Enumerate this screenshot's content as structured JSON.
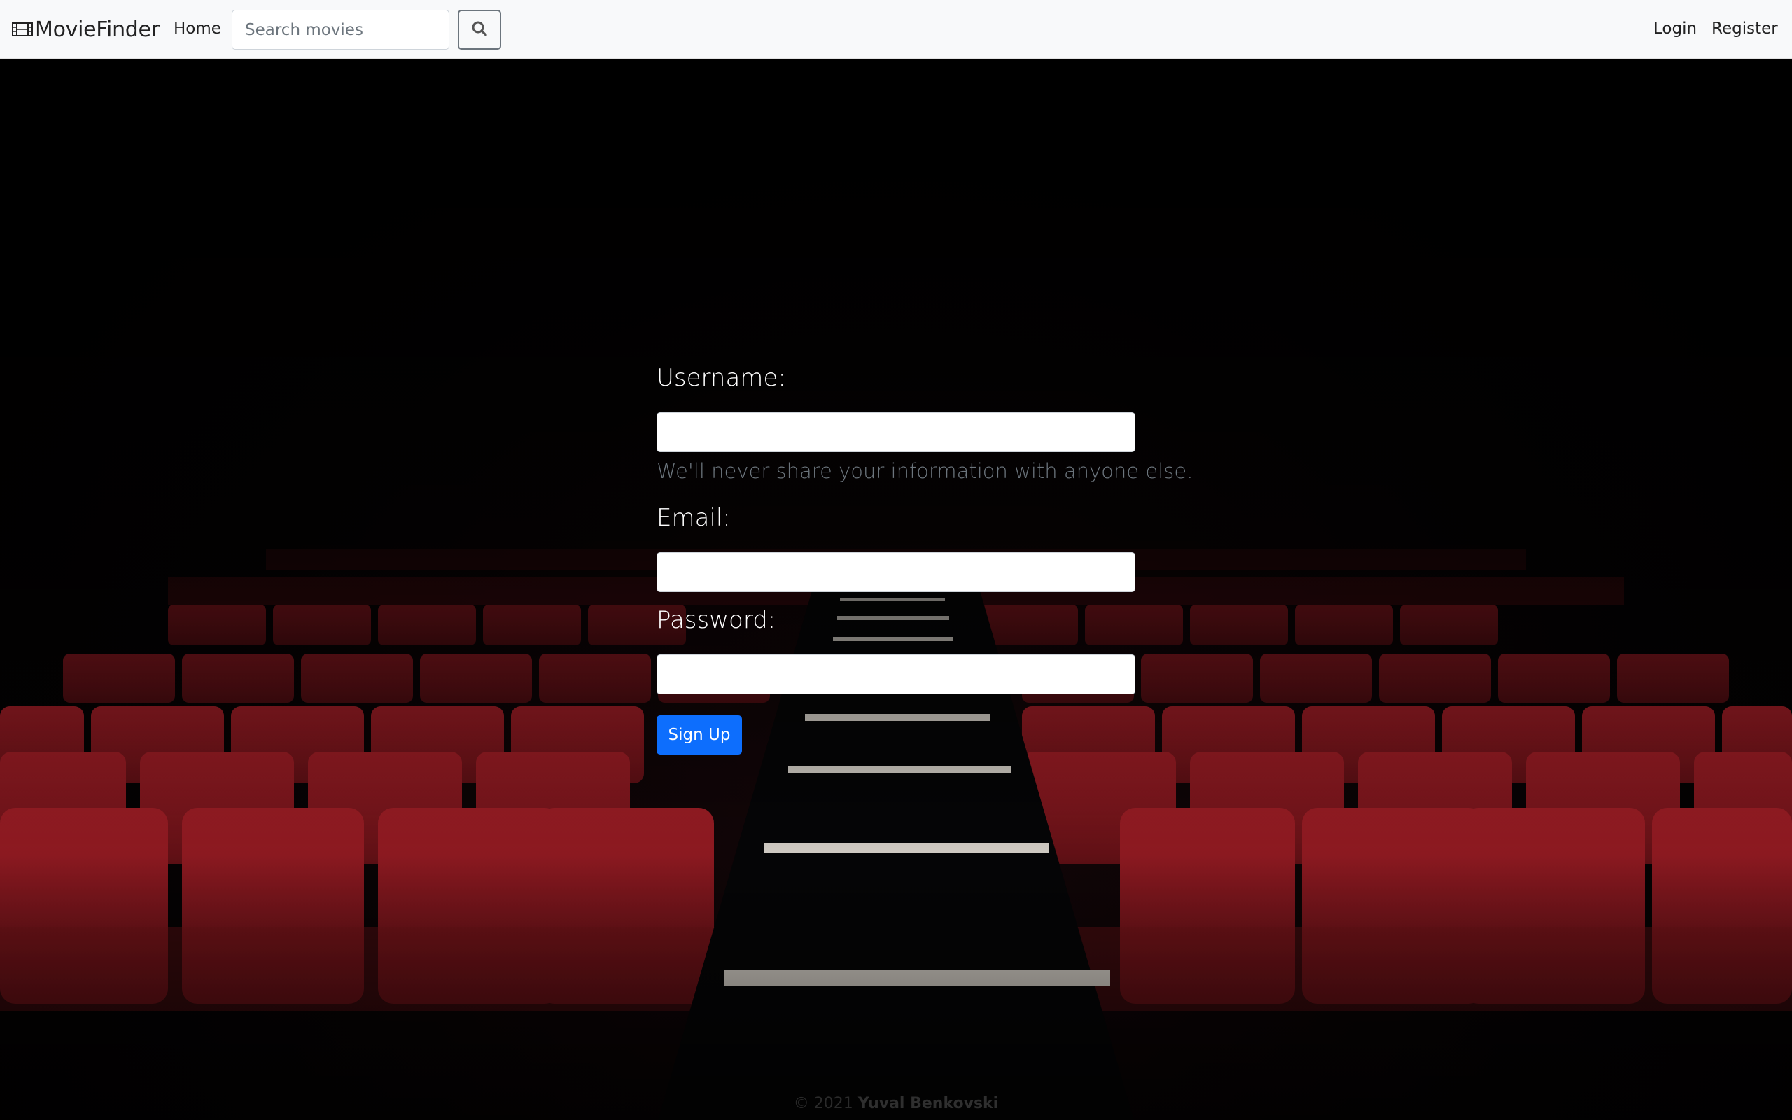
{
  "navbar": {
    "brand": "MovieFinder",
    "brand_icon": "film-icon",
    "home": "Home",
    "search_placeholder": "Search movies",
    "search_icon": "search-icon",
    "login": "Login",
    "register": "Register"
  },
  "form": {
    "username_label": "Username:",
    "username_help": "We'll never share your information with anyone else.",
    "email_label": "Email:",
    "password_label": "Password:",
    "submit": "Sign Up"
  },
  "footer": {
    "copyright": "© 2021",
    "author": "Yuval Benkovski"
  },
  "colors": {
    "primary": "#0d6efd",
    "navbar_bg": "#f8f9fa",
    "seat_red": "#8b1a20"
  }
}
